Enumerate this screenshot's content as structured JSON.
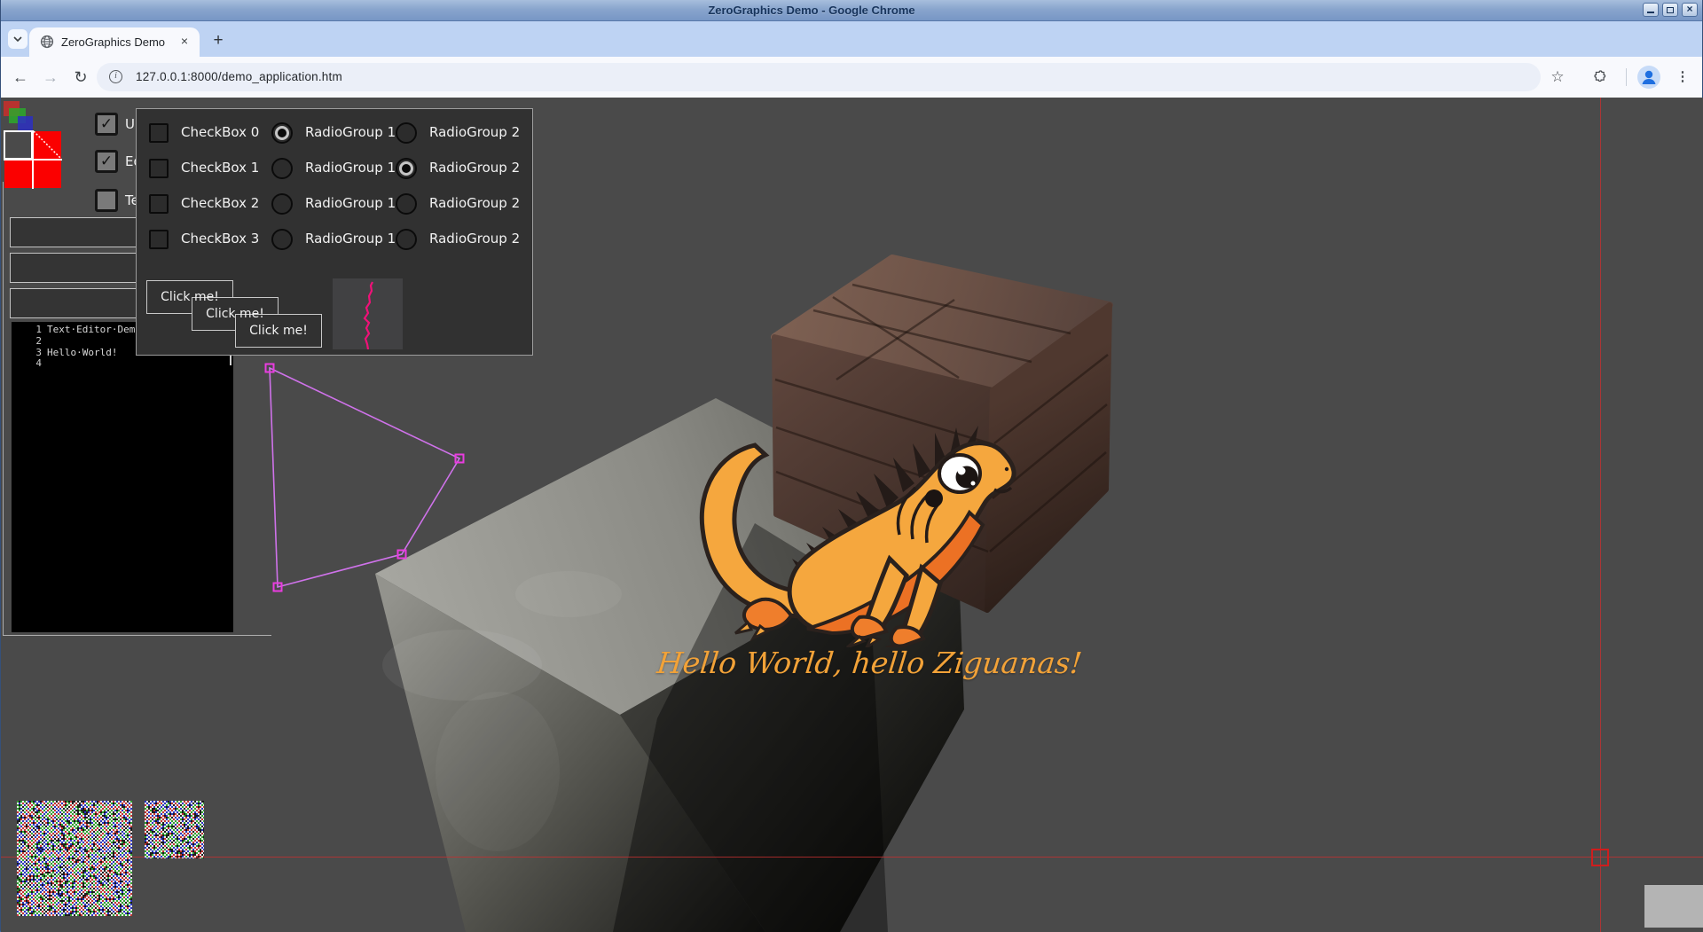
{
  "window": {
    "title": "ZeroGraphics Demo - Google Chrome"
  },
  "browser": {
    "tab": {
      "title": "ZeroGraphics Demo",
      "close_glyph": "×"
    },
    "new_tab_glyph": "+",
    "nav": {
      "back": "←",
      "forward": "→",
      "reload": "↻",
      "info": "i"
    },
    "url": "127.0.0.1:8000/demo_application.htm",
    "bookmark_glyph": "☆",
    "menu_glyph": "⋮",
    "close_glyph": "×"
  },
  "app": {
    "check_glyph": "✓",
    "left_checkboxes": [
      {
        "label": "UI",
        "checked": true
      },
      {
        "label": "Ed",
        "checked": true
      },
      {
        "label": "Te",
        "checked": false
      }
    ],
    "editor": {
      "lines": [
        {
          "num": "1",
          "text": "Text·Editor·Demo"
        },
        {
          "num": "2",
          "text": ""
        },
        {
          "num": "3",
          "text": "Hello·World!"
        },
        {
          "num": "4",
          "text": ""
        }
      ]
    },
    "panel": {
      "rows": [
        {
          "checkbox": "CheckBox 0",
          "checkbox_checked": false,
          "radio1": "RadioGroup 1",
          "radio1_selected": true,
          "radio2": "RadioGroup 2",
          "radio2_selected": false
        },
        {
          "checkbox": "CheckBox 1",
          "checkbox_checked": false,
          "radio1": "RadioGroup 1",
          "radio1_selected": false,
          "radio2": "RadioGroup 2",
          "radio2_selected": true
        },
        {
          "checkbox": "CheckBox 2",
          "checkbox_checked": false,
          "radio1": "RadioGroup 1",
          "radio1_selected": false,
          "radio2": "RadioGroup 2",
          "radio2_selected": false
        },
        {
          "checkbox": "CheckBox 3",
          "checkbox_checked": false,
          "radio1": "RadioGroup 1",
          "radio1_selected": false,
          "radio2": "RadioGroup 2",
          "radio2_selected": false
        }
      ],
      "buttons": [
        "Click me!",
        "Click me!",
        "Click me!"
      ]
    },
    "scene": {
      "caption": "Hello World, hello Ziguanas!"
    },
    "colors": {
      "polygon_line": "#cf72ea",
      "polygon_handle": "#ea3ce0",
      "plot_pink": "#f01178",
      "crosshair_red": "#cf1d1d",
      "caption_orange": "#f2a238",
      "texture_palette": [
        "#c23232",
        "#2fa32f",
        "#2a35c2",
        "#e9e9e9",
        "#1c1c1c"
      ]
    }
  }
}
